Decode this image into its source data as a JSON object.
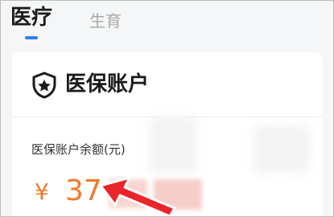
{
  "tabs": [
    {
      "label": "医疗",
      "active": true
    },
    {
      "label": "生育",
      "active": false
    }
  ],
  "card": {
    "title": "医保账户",
    "title_icon": "shield-star-icon",
    "balance_label": "医保账户余额(元)",
    "balance_currency": "¥",
    "balance_amount_visible": "37"
  },
  "colors": {
    "accent": "#2f7df6",
    "amount": "#f0782a",
    "arrow": "#e8252a",
    "text": "#1b1b1b",
    "muted": "#a9a9a9"
  },
  "annotation": {
    "icon": "red-arrow-icon"
  }
}
